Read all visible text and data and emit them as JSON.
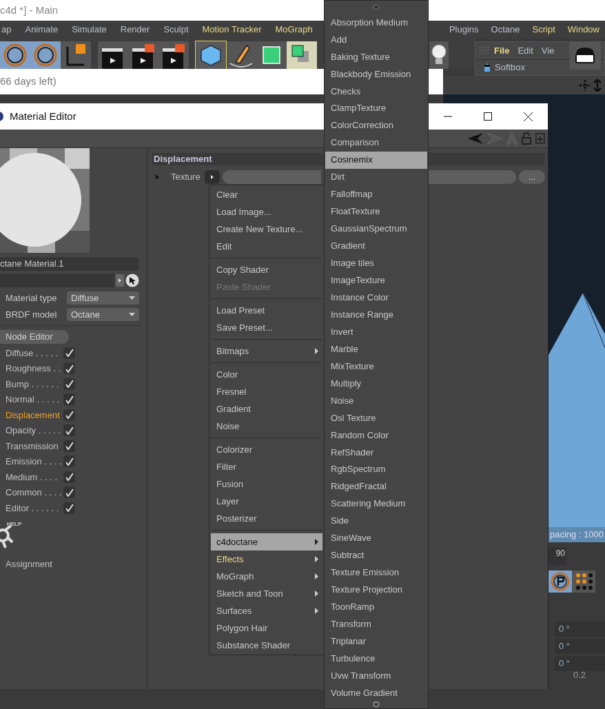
{
  "main_window": {
    "title": "c4d *] - Main",
    "menu": [
      {
        "label": "ap",
        "accent": false
      },
      {
        "label": "Animate",
        "accent": false
      },
      {
        "label": "Simulate",
        "accent": false
      },
      {
        "label": "Render",
        "accent": false
      },
      {
        "label": "Sculpt",
        "accent": false
      },
      {
        "label": "Motion Tracker",
        "accent": true
      },
      {
        "label": "MoGraph",
        "accent": true
      }
    ],
    "menu_right": [
      {
        "label": "Plugins",
        "accent": false
      },
      {
        "label": "Octane",
        "accent": false
      },
      {
        "label": "Script",
        "accent": true
      },
      {
        "label": "Window",
        "accent": true
      }
    ],
    "notice": "66 days left)",
    "object_manager": {
      "menu": [
        {
          "label": "File",
          "accent": true
        },
        {
          "label": "Edit",
          "accent": false
        },
        {
          "label": "Vie",
          "accent": false
        }
      ],
      "tree_item": "Softbox"
    },
    "viewport": {
      "info": "pacing : 1000"
    },
    "coordinates": {
      "ruler_value": "90",
      "rotation_fields": [
        "0 °",
        "0 °",
        "0 °"
      ],
      "scale_label": "0.2"
    }
  },
  "material_editor": {
    "title": "Material Editor",
    "name": "ctane Material.1",
    "material_type": {
      "label": "Material type",
      "value": "Diffuse"
    },
    "brdf_model": {
      "label": "BRDF model",
      "value": "Octane"
    },
    "node_editor": "Node Editor",
    "channels": [
      {
        "label": "Diffuse . . . . .",
        "checked": true,
        "selected": false
      },
      {
        "label": "Roughness . .",
        "checked": true,
        "selected": false
      },
      {
        "label": "Bump . . . . . .",
        "checked": true,
        "selected": false
      },
      {
        "label": "Normal . . . . .",
        "checked": true,
        "selected": false
      },
      {
        "label": "Displacement",
        "checked": true,
        "selected": true
      },
      {
        "label": "Opacity . . . . .",
        "checked": true,
        "selected": false
      },
      {
        "label": "Transmission",
        "checked": true,
        "selected": false
      },
      {
        "label": "Emission . . . .",
        "checked": true,
        "selected": false
      },
      {
        "label": "Medium . . . .",
        "checked": true,
        "selected": false
      },
      {
        "label": "Common . . . .",
        "checked": true,
        "selected": false
      },
      {
        "label": "Editor . . . . . .",
        "checked": true,
        "selected": false
      }
    ],
    "help_badge": "HELP",
    "assignment": "Assignment",
    "section": "Displacement",
    "texture_label": "Texture",
    "browse_button": "..."
  },
  "context_menu": {
    "groups": [
      [
        {
          "label": "Clear",
          "submenu": false,
          "selected": false,
          "disabled": false,
          "accent": false
        },
        {
          "label": "Load Image...",
          "submenu": false,
          "selected": false,
          "disabled": false,
          "accent": false
        },
        {
          "label": "Create New Texture...",
          "submenu": false,
          "selected": false,
          "disabled": false,
          "accent": false
        },
        {
          "label": "Edit",
          "submenu": false,
          "selected": false,
          "disabled": false,
          "accent": false
        }
      ],
      [
        {
          "label": "Copy Shader",
          "submenu": false,
          "selected": false,
          "disabled": false,
          "accent": false
        },
        {
          "label": "Paste Shader",
          "submenu": false,
          "selected": false,
          "disabled": true,
          "accent": false
        }
      ],
      [
        {
          "label": "Load Preset",
          "submenu": false,
          "selected": false,
          "disabled": false,
          "accent": false
        },
        {
          "label": "Save Preset...",
          "submenu": false,
          "selected": false,
          "disabled": false,
          "accent": false
        }
      ],
      [
        {
          "label": "Bitmaps",
          "submenu": true,
          "selected": false,
          "disabled": false,
          "accent": false
        }
      ],
      [
        {
          "label": "Color",
          "submenu": false,
          "selected": false,
          "disabled": false,
          "accent": false
        },
        {
          "label": "Fresnel",
          "submenu": false,
          "selected": false,
          "disabled": false,
          "accent": false
        },
        {
          "label": "Gradient",
          "submenu": false,
          "selected": false,
          "disabled": false,
          "accent": false
        },
        {
          "label": "Noise",
          "submenu": false,
          "selected": false,
          "disabled": false,
          "accent": false
        }
      ],
      [
        {
          "label": "Colorizer",
          "submenu": false,
          "selected": false,
          "disabled": false,
          "accent": false
        },
        {
          "label": "Filter",
          "submenu": false,
          "selected": false,
          "disabled": false,
          "accent": false
        },
        {
          "label": "Fusion",
          "submenu": false,
          "selected": false,
          "disabled": false,
          "accent": false
        },
        {
          "label": "Layer",
          "submenu": false,
          "selected": false,
          "disabled": false,
          "accent": false
        },
        {
          "label": "Posterizer",
          "submenu": false,
          "selected": false,
          "disabled": false,
          "accent": false
        }
      ],
      [
        {
          "label": "c4doctane",
          "submenu": true,
          "selected": true,
          "disabled": false,
          "accent": false
        },
        {
          "label": "Effects",
          "submenu": true,
          "selected": false,
          "disabled": false,
          "accent": true
        },
        {
          "label": "MoGraph",
          "submenu": true,
          "selected": false,
          "disabled": false,
          "accent": false
        },
        {
          "label": "Sketch and Toon",
          "submenu": true,
          "selected": false,
          "disabled": false,
          "accent": false
        },
        {
          "label": "Surfaces",
          "submenu": true,
          "selected": false,
          "disabled": false,
          "accent": false
        },
        {
          "label": "Polygon Hair",
          "submenu": false,
          "selected": false,
          "disabled": false,
          "accent": false
        },
        {
          "label": "Substance Shader",
          "submenu": false,
          "selected": false,
          "disabled": false,
          "accent": false
        }
      ]
    ]
  },
  "submenu": {
    "items": [
      {
        "label": "Absorption Medium",
        "selected": false
      },
      {
        "label": "Add",
        "selected": false
      },
      {
        "label": "Baking Texture",
        "selected": false
      },
      {
        "label": "Blackbody Emission",
        "selected": false
      },
      {
        "label": "Checks",
        "selected": false
      },
      {
        "label": "ClampTexture",
        "selected": false
      },
      {
        "label": "ColorCorrection",
        "selected": false
      },
      {
        "label": "Comparison",
        "selected": false
      },
      {
        "label": "Cosinemix",
        "selected": true
      },
      {
        "label": "Dirt",
        "selected": false
      },
      {
        "label": "Falloffmap",
        "selected": false
      },
      {
        "label": "FloatTexture",
        "selected": false
      },
      {
        "label": "GaussianSpectrum",
        "selected": false
      },
      {
        "label": "Gradient",
        "selected": false
      },
      {
        "label": "Image tiles",
        "selected": false
      },
      {
        "label": "ImageTexture",
        "selected": false
      },
      {
        "label": "Instance Color",
        "selected": false
      },
      {
        "label": "Instance Range",
        "selected": false
      },
      {
        "label": "Invert",
        "selected": false
      },
      {
        "label": "Marble",
        "selected": false
      },
      {
        "label": "MixTexture",
        "selected": false
      },
      {
        "label": "Multiply",
        "selected": false
      },
      {
        "label": "Noise",
        "selected": false
      },
      {
        "label": "Osl Texture",
        "selected": false
      },
      {
        "label": "Random Color",
        "selected": false
      },
      {
        "label": "RefShader",
        "selected": false
      },
      {
        "label": "RgbSpectrum",
        "selected": false
      },
      {
        "label": "RidgedFractal",
        "selected": false
      },
      {
        "label": "Scattering Medium",
        "selected": false
      },
      {
        "label": "Side",
        "selected": false
      },
      {
        "label": "SineWave",
        "selected": false
      },
      {
        "label": "Subtract",
        "selected": false
      },
      {
        "label": "Texture Emission",
        "selected": false
      },
      {
        "label": "Texture Projection",
        "selected": false
      },
      {
        "label": "ToonRamp",
        "selected": false
      },
      {
        "label": "Transform",
        "selected": false
      },
      {
        "label": "Triplanar",
        "selected": false
      },
      {
        "label": "Turbulence",
        "selected": false
      },
      {
        "label": "Uvw Transform",
        "selected": false
      },
      {
        "label": "Volume Gradient",
        "selected": false
      }
    ]
  }
}
